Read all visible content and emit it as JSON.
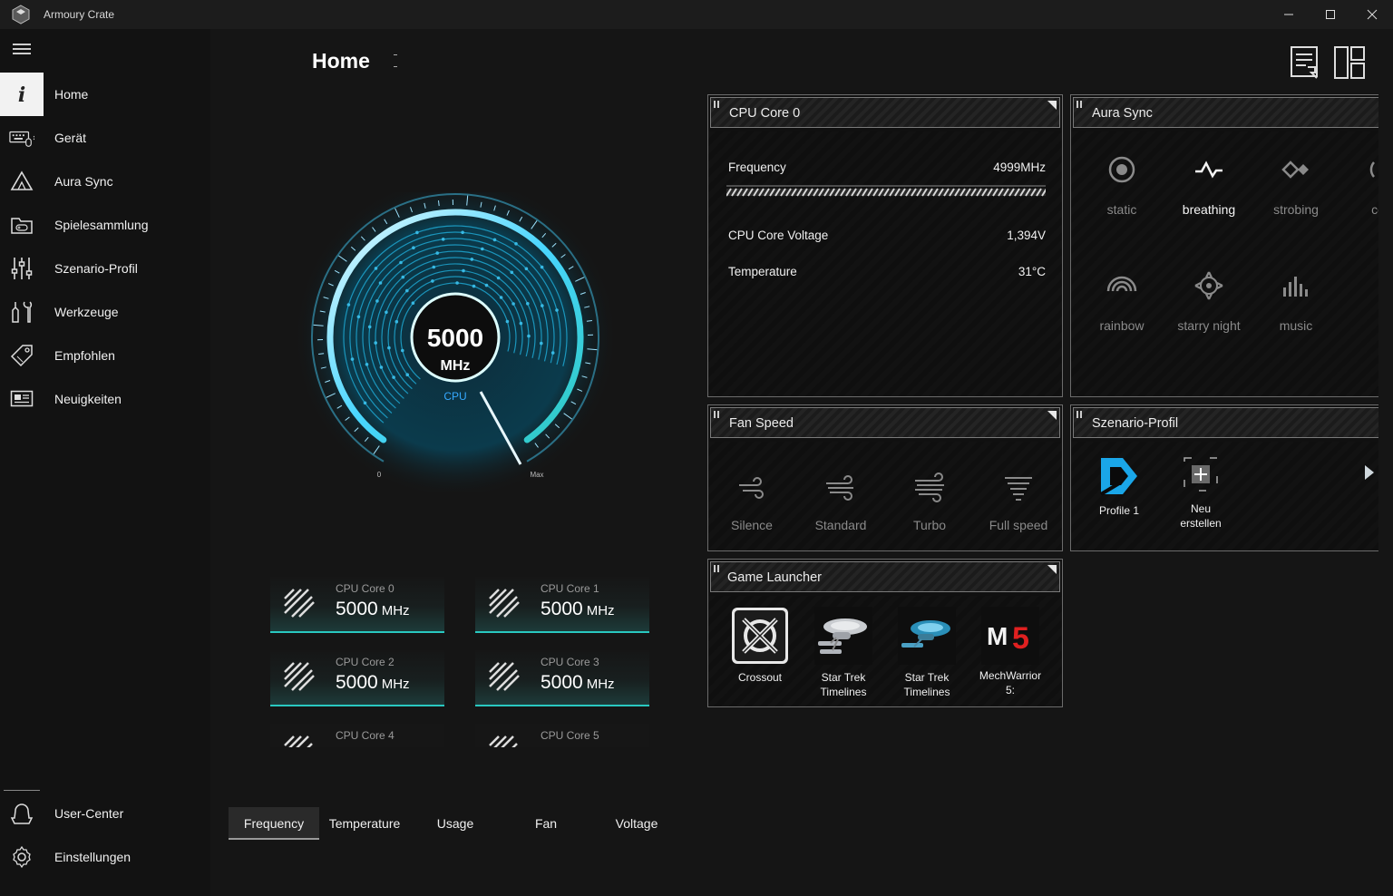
{
  "window": {
    "title": "Armoury Crate"
  },
  "sidebar": {
    "items": [
      {
        "label": "Home",
        "icon": "info-icon"
      },
      {
        "label": "Gerät",
        "icon": "keyboard-mouse-icon"
      },
      {
        "label": "Aura Sync",
        "icon": "aura-triangle-icon"
      },
      {
        "label": "Spielesammlung",
        "icon": "game-library-icon"
      },
      {
        "label": "Szenario-Profil",
        "icon": "sliders-icon"
      },
      {
        "label": "Werkzeuge",
        "icon": "tools-icon"
      },
      {
        "label": "Empfohlen",
        "icon": "tag-icon"
      },
      {
        "label": "Neuigkeiten",
        "icon": "news-icon"
      }
    ],
    "bottom": [
      {
        "label": "User-Center",
        "icon": "user-icon"
      },
      {
        "label": "Einstellungen",
        "icon": "gear-icon"
      }
    ]
  },
  "main": {
    "title": "Home",
    "gauge": {
      "value": "5000",
      "unit": "MHz",
      "label": "CPU",
      "min": "0",
      "max": "Max"
    },
    "cores": [
      {
        "name": "CPU Core 0",
        "value": "5000",
        "unit": "MHz"
      },
      {
        "name": "CPU Core 1",
        "value": "5000",
        "unit": "MHz"
      },
      {
        "name": "CPU Core 2",
        "value": "5000",
        "unit": "MHz"
      },
      {
        "name": "CPU Core 3",
        "value": "5000",
        "unit": "MHz"
      },
      {
        "name": "CPU Core 4"
      },
      {
        "name": "CPU Core 5"
      }
    ],
    "tabs": [
      "Frequency",
      "Temperature",
      "Usage",
      "Fan",
      "Voltage"
    ],
    "active_tab": "Frequency"
  },
  "panels": {
    "cpu": {
      "title": "CPU Core 0",
      "frequency_label": "Frequency",
      "frequency_value": "4999MHz",
      "voltage_label": "CPU Core Voltage",
      "voltage_value": "1,394V",
      "temperature_label": "Temperature",
      "temperature_value": "31°C"
    },
    "aura": {
      "title": "Aura Sync",
      "modes": [
        {
          "label": "static",
          "icon": "static-icon"
        },
        {
          "label": "breathing",
          "icon": "breathing-icon"
        },
        {
          "label": "strobing",
          "icon": "strobing-icon"
        },
        {
          "label": "colo",
          "icon": "color-cycle-icon"
        },
        {
          "label": "rainbow",
          "icon": "rainbow-icon"
        },
        {
          "label": "starry night",
          "icon": "starry-night-icon"
        },
        {
          "label": "music",
          "icon": "music-icon"
        }
      ],
      "active": "breathing"
    },
    "fan": {
      "title": "Fan Speed",
      "modes": [
        {
          "label": "Silence",
          "icon": "fan-silence-icon"
        },
        {
          "label": "Standard",
          "icon": "fan-standard-icon"
        },
        {
          "label": "Turbo",
          "icon": "fan-turbo-icon"
        },
        {
          "label": "Full speed",
          "icon": "fan-fullspeed-icon"
        }
      ]
    },
    "scenario": {
      "title": "Szenario-Profil",
      "profiles": [
        {
          "label": "Profile 1",
          "icon": "profile-logo-icon"
        },
        {
          "label_line1": "Neu",
          "label_line2": "erstellen",
          "icon": "add-icon"
        }
      ]
    },
    "games": {
      "title": "Game Launcher",
      "items": [
        {
          "line1": "Crossout",
          "line2": "",
          "icon": "crossout-icon"
        },
        {
          "line1": "Star Trek",
          "line2": "Timelines",
          "icon": "starship-icon"
        },
        {
          "line1": "Star Trek",
          "line2": "Timelines",
          "icon": "starship-icon"
        },
        {
          "line1": "MechWarrior",
          "line2": "5:",
          "icon": "mechwarrior-icon"
        }
      ]
    }
  },
  "colors": {
    "accent": "#29c8c0",
    "gauge": "#2ab8e0",
    "bg": "#151515"
  }
}
